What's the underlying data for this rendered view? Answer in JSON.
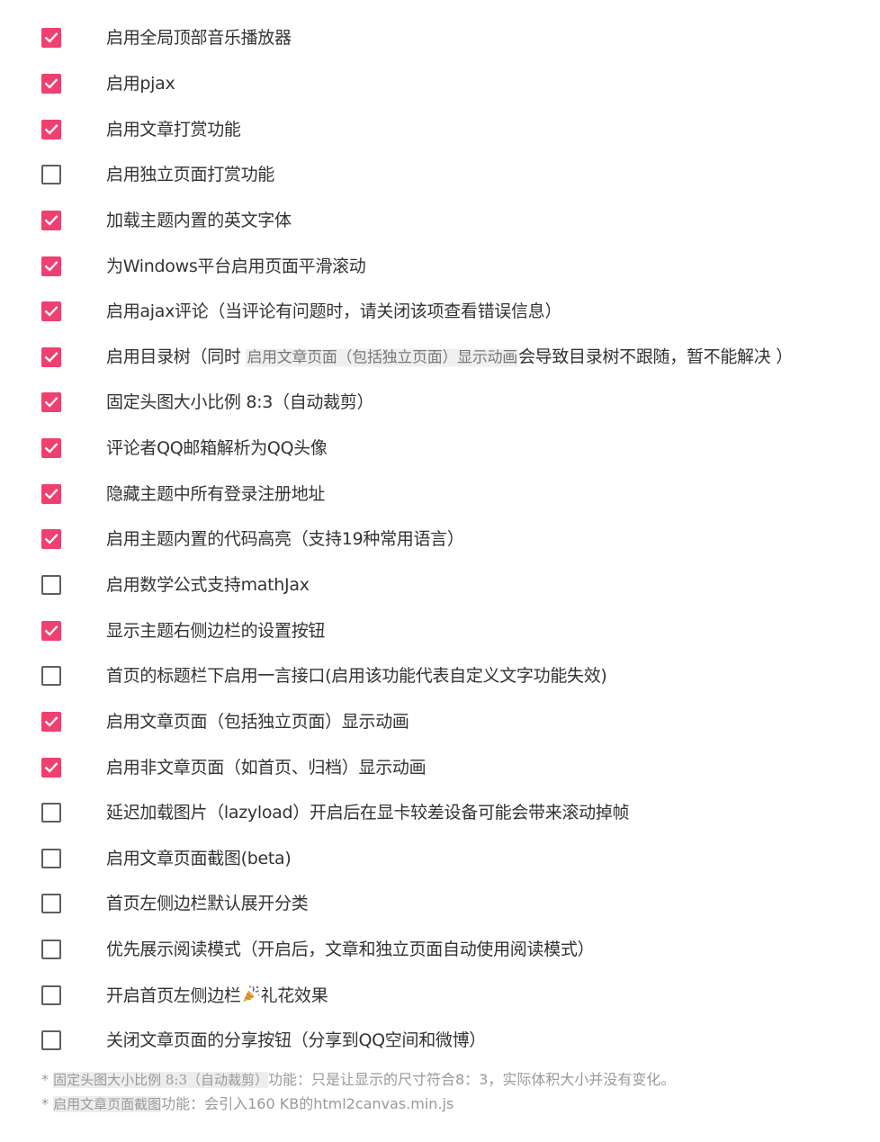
{
  "colors": {
    "accent": "#f0406f",
    "checkbox_border": "#5f5f5f",
    "text": "#333333",
    "note_text": "#999999"
  },
  "options": [
    {
      "label": "启用全局顶部音乐播放器",
      "checked": true
    },
    {
      "label": "启用pjax",
      "checked": true
    },
    {
      "label": "启用文章打赏功能",
      "checked": true
    },
    {
      "label": "启用独立页面打赏功能",
      "checked": false
    },
    {
      "label": "加载主题内置的英文字体",
      "checked": true
    },
    {
      "label": "为Windows平台启用页面平滑滚动",
      "checked": true
    },
    {
      "label": "启用ajax评论（当评论有问题时，请关闭该项查看错误信息）",
      "checked": true
    },
    {
      "label_prefix": "启用目录树（同时 ",
      "label_code": "启用文章页面（包括独立页面）显示动画",
      "label_suffix": "会导致目录树不跟随，暂不能解决 ）",
      "checked": true
    },
    {
      "label": "固定头图大小比例 8:3（自动裁剪）",
      "checked": true
    },
    {
      "label": "评论者QQ邮箱解析为QQ头像",
      "checked": true
    },
    {
      "label": "隐藏主题中所有登录注册地址",
      "checked": true
    },
    {
      "label": "启用主题内置的代码高亮（支持19种常用语言）",
      "checked": true
    },
    {
      "label": "启用数学公式支持mathJax",
      "checked": false
    },
    {
      "label": "显示主题右侧边栏的设置按钮",
      "checked": true
    },
    {
      "label": "首页的标题栏下启用一言接口(启用该功能代表自定义文字功能失效)",
      "checked": false
    },
    {
      "label": "启用文章页面（包括独立页面）显示动画",
      "checked": true
    },
    {
      "label": "启用非文章页面（如首页、归档）显示动画",
      "checked": true
    },
    {
      "label": "延迟加载图片（lazyload）开启后在显卡较差设备可能会带来滚动掉帧",
      "checked": false
    },
    {
      "label": "启用文章页面截图(beta)",
      "checked": false
    },
    {
      "label": "首页左侧边栏默认展开分类",
      "checked": false
    },
    {
      "label": "优先展示阅读模式（开启后，文章和独立页面自动使用阅读模式）",
      "checked": false
    },
    {
      "label_prefix": "开启首页左侧边栏",
      "label_icon": "party-popper-icon",
      "label_suffix": "礼花效果",
      "checked": false
    },
    {
      "label": "关闭文章页面的分享按钮（分享到QQ空间和微博）",
      "checked": false
    }
  ],
  "notes": [
    {
      "prefix": "* ",
      "code": "固定头图大小比例 8:3（自动裁剪）",
      "text": "功能：只是让显示的尺寸符合8：3，实际体积大小并没有变化。"
    },
    {
      "prefix": "* ",
      "code": "启用文章页面截图",
      "text": "功能：会引入160 KB的html2canvas.min.js"
    }
  ]
}
